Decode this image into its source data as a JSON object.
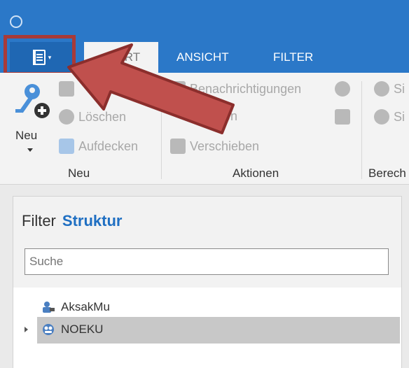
{
  "titlebar": {
    "app_icon": "circle-icon"
  },
  "file_menu": {
    "icon": "document-list-icon"
  },
  "tabs": [
    {
      "label": "START",
      "active": true
    },
    {
      "label": "ANSICHT",
      "active": false
    },
    {
      "label": "FILTER",
      "active": false
    }
  ],
  "ribbon": {
    "neu": {
      "label": "Neu",
      "icon": "key-add-icon"
    },
    "neu_group": {
      "label": "Neu",
      "items": [
        {
          "label": "",
          "icon": "image-icon"
        },
        {
          "label": "Löschen",
          "icon": "minus-circle-icon"
        },
        {
          "label": "Aufdecken",
          "icon": "lock-icon"
        }
      ]
    },
    "aktionen_group": {
      "label": "Aktionen",
      "items": [
        {
          "label": "Benachrichtigungen",
          "icon": "warning-icon"
        },
        {
          "label": "zieren",
          "icon": "copy-icon"
        },
        {
          "label": "Verschieben",
          "icon": "move-icon"
        }
      ],
      "star_icon": "star-icon",
      "note_icon": "note-icon"
    },
    "berech_group": {
      "label": "Berech",
      "items": [
        {
          "label": "Si",
          "icon": "user-icon"
        },
        {
          "label": "Si",
          "icon": "eye-icon"
        }
      ]
    }
  },
  "panel": {
    "title_filter": "Filter",
    "title_struktur": "Struktur",
    "search_placeholder": "Suche",
    "tree": [
      {
        "label": "AksakMu",
        "icon": "user-computer-icon",
        "selected": false
      },
      {
        "label": "NOEKU",
        "icon": "network-icon",
        "selected": true
      }
    ]
  },
  "annotation": {
    "arrow_color": "#c0504d",
    "highlight_color": "#a83a38"
  },
  "colors": {
    "accent": "#2b78c8",
    "struktur": "#1f6fc2"
  }
}
